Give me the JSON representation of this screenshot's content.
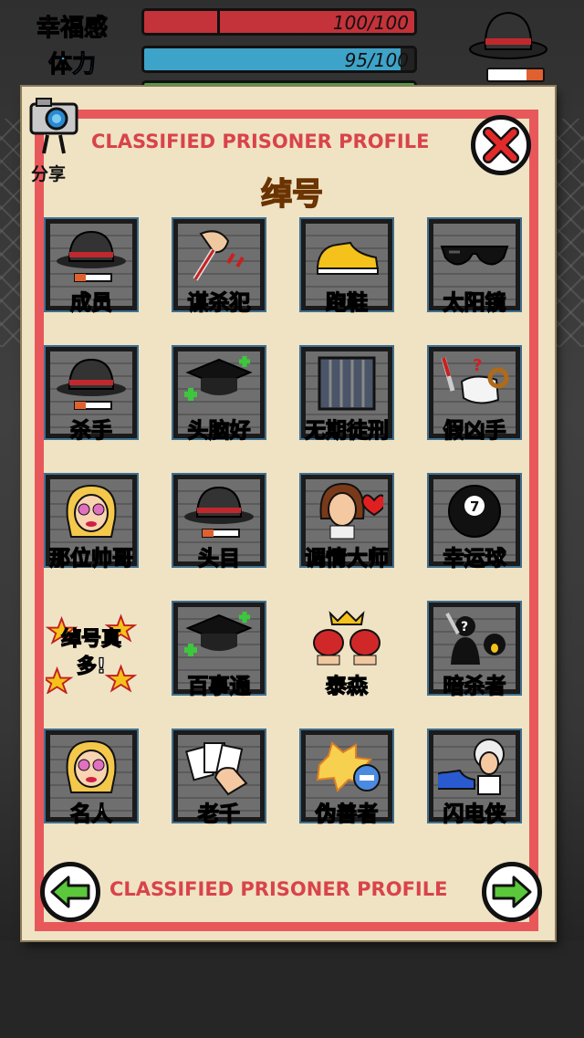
{
  "stats": [
    {
      "label": "幸福感",
      "value_text": "100/100",
      "fill": 1.0,
      "color": "#c4323a",
      "label_color": "#d83a3a"
    },
    {
      "label": "体力",
      "value_text": "95/100",
      "fill": 0.95,
      "color": "#3ea3c8",
      "label_color": "#3ea3e0"
    },
    {
      "label": "",
      "value_text": "",
      "fill": 1.0,
      "color": "#4aa84a",
      "label_color": "#4aa84a"
    }
  ],
  "share": {
    "label": "分享",
    "icon": "camera-icon"
  },
  "profile": {
    "header": "CLASSIFIED PRISONER PROFILE",
    "title": "绰号",
    "footer": "CLASSIFIED PRISONER PROFILE"
  },
  "controls": {
    "close_icon": "close-icon",
    "prev_icon": "arrow-left-icon",
    "next_icon": "arrow-right-icon"
  },
  "nicknames": [
    {
      "label": "成员",
      "icon": "fedora-icon"
    },
    {
      "label": "谋杀犯",
      "icon": "knife-hand-icon"
    },
    {
      "label": "跑鞋",
      "icon": "sneaker-icon"
    },
    {
      "label": "太阳镜",
      "icon": "sunglasses-icon"
    },
    {
      "label": "杀手",
      "icon": "fedora-icon"
    },
    {
      "label": "头脑好",
      "icon": "graduation-cap-icon"
    },
    {
      "label": "无期徒刑",
      "icon": "jail-cell-icon",
      "highlight": true
    },
    {
      "label": "假凶手",
      "icon": "ram-knife-icon"
    },
    {
      "label": "那位帅哥",
      "icon": "blonde-woman-icon"
    },
    {
      "label": "头目",
      "icon": "fedora-icon"
    },
    {
      "label": "调情大师",
      "icon": "woman-heart-icon"
    },
    {
      "label": "幸运球",
      "icon": "eight-ball-icon"
    },
    {
      "label": "绰号真多!",
      "icon": "stars-badge-icon"
    },
    {
      "label": "百事通",
      "icon": "graduation-cap-icon"
    },
    {
      "label": "泰森",
      "icon": "boxing-gloves-icon"
    },
    {
      "label": "暗杀者",
      "icon": "assassin-icon"
    },
    {
      "label": "名人",
      "icon": "blonde-woman-icon"
    },
    {
      "label": "老千",
      "icon": "playing-cards-icon"
    },
    {
      "label": "伪善者",
      "icon": "explosion-minus-icon"
    },
    {
      "label": "闪电侠",
      "icon": "scientist-shoe-icon"
    }
  ]
}
